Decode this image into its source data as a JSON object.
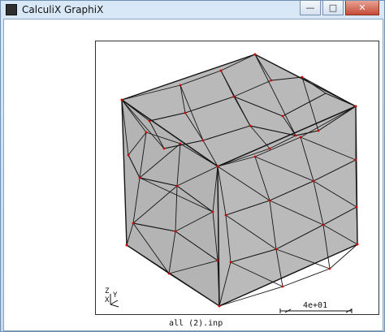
{
  "window": {
    "title": "CalculiX GraphiX",
    "controls": {
      "minimize": "—",
      "maximize": "□",
      "close": "✕"
    }
  },
  "viewport": {
    "scale_value": "4e+01",
    "file_label": "all (2).inp",
    "axis": {
      "z": "Z",
      "y": "Y",
      "x": "X"
    }
  },
  "colors": {
    "mesh_fill": "#b7b7b7",
    "mesh_line": "#151515",
    "node": "#d10000"
  }
}
